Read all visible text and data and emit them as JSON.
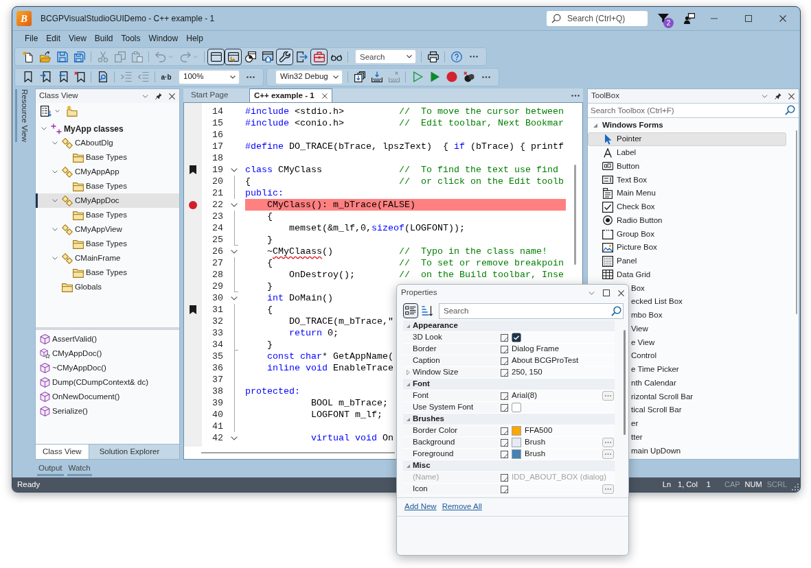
{
  "window": {
    "logo": "B",
    "title": "BCGPVisualStudioGUIDemo - C++ example - 1",
    "search": {
      "placeholder": "Search (Ctrl+Q)"
    },
    "notification_count": "2"
  },
  "menu": [
    "File",
    "Edit",
    "View",
    "Build",
    "Tools",
    "Window",
    "Help"
  ],
  "toolbar_rows": [
    {
      "panels": [
        {
          "items": [
            {
              "kind": "button",
              "pressed": false,
              "disabled": false
            },
            {
              "kind": "button",
              "pressed": false,
              "disabled": false
            },
            {
              "kind": "button",
              "pressed": false,
              "disabled": false
            },
            {
              "kind": "button",
              "pressed": false,
              "disabled": false
            },
            {
              "kind": "separator"
            },
            {
              "kind": "button",
              "pressed": false,
              "disabled": true
            },
            {
              "kind": "button",
              "pressed": false,
              "disabled": true
            },
            {
              "kind": "button",
              "pressed": false,
              "disabled": true
            },
            {
              "kind": "separator"
            },
            {
              "kind": "split-button",
              "pressed": false,
              "disabled": true
            },
            {
              "kind": "split-button",
              "pressed": false,
              "disabled": true
            },
            {
              "kind": "separator"
            },
            {
              "kind": "button",
              "pressed": true,
              "disabled": false
            },
            {
              "kind": "button",
              "pressed": true,
              "disabled": false
            },
            {
              "kind": "button",
              "pressed": false,
              "disabled": false
            },
            {
              "kind": "button",
              "pressed": false,
              "disabled": false
            },
            {
              "kind": "button",
              "pressed": true,
              "disabled": false
            },
            {
              "kind": "button",
              "pressed": false,
              "disabled": false
            },
            {
              "kind": "button",
              "pressed": true,
              "disabled": false
            },
            {
              "kind": "button",
              "pressed": false,
              "disabled": false
            },
            {
              "kind": "separator"
            },
            {
              "kind": "combo",
              "placeholder": "Search"
            },
            {
              "kind": "separator"
            },
            {
              "kind": "button",
              "pressed": false,
              "disabled": false
            },
            {
              "kind": "separator"
            },
            {
              "kind": "button",
              "pressed": false,
              "disabled": false
            },
            {
              "kind": "more"
            }
          ]
        }
      ]
    },
    {
      "panels": [
        {
          "items": [
            {
              "kind": "button",
              "pressed": false,
              "disabled": false
            },
            {
              "kind": "button",
              "pressed": false,
              "disabled": false
            },
            {
              "kind": "button",
              "pressed": false,
              "disabled": false
            },
            {
              "kind": "button",
              "pressed": false,
              "disabled": false
            },
            {
              "kind": "separator"
            },
            {
              "kind": "button",
              "pressed": false,
              "disabled": false
            },
            {
              "kind": "separator"
            },
            {
              "kind": "button",
              "pressed": false,
              "disabled": true
            },
            {
              "kind": "button",
              "pressed": false,
              "disabled": true
            },
            {
              "kind": "separator"
            },
            {
              "kind": "text-button",
              "label": "a·b"
            },
            {
              "kind": "combo",
              "value": "100%"
            },
            {
              "kind": "more"
            }
          ]
        },
        {
          "items": [
            {
              "kind": "combo",
              "value": "Win32 Debug"
            },
            {
              "kind": "separator"
            },
            {
              "kind": "button",
              "pressed": false,
              "disabled": false
            },
            {
              "kind": "button",
              "pressed": false,
              "disabled": false
            },
            {
              "kind": "button",
              "pressed": false,
              "disabled": true
            },
            {
              "kind": "separator"
            },
            {
              "kind": "button",
              "pressed": false,
              "disabled": false
            },
            {
              "kind": "button",
              "pressed": false,
              "disabled": false
            },
            {
              "kind": "button",
              "pressed": false,
              "disabled": false
            },
            {
              "kind": "button",
              "pressed": false,
              "disabled": false
            },
            {
              "kind": "more"
            }
          ]
        }
      ]
    }
  ],
  "side_tabs": [
    "Resource View"
  ],
  "class_view": {
    "title": "Class View",
    "tree": [
      {
        "label": "MyApp classes",
        "kind": "namespace",
        "expanded": true,
        "selected": false,
        "children": [
          {
            "label": "CAboutDlg",
            "kind": "class",
            "expanded": true,
            "selected": false,
            "children": [
              {
                "label": "Base Types",
                "kind": "folder",
                "selected": false
              }
            ]
          },
          {
            "label": "CMyAppApp",
            "kind": "class",
            "expanded": true,
            "selected": false,
            "children": [
              {
                "label": "Base Types",
                "kind": "folder",
                "selected": false
              }
            ]
          },
          {
            "label": "CMyAppDoc",
            "kind": "class",
            "expanded": true,
            "selected": true,
            "children": [
              {
                "label": "Base Types",
                "kind": "folder",
                "selected": false
              }
            ]
          },
          {
            "label": "CMyAppView",
            "kind": "class",
            "expanded": true,
            "selected": false,
            "children": [
              {
                "label": "Base Types",
                "kind": "folder",
                "selected": false
              }
            ]
          },
          {
            "label": "CMainFrame",
            "kind": "class",
            "expanded": true,
            "selected": false,
            "children": [
              {
                "label": "Base Types",
                "kind": "folder",
                "selected": false
              }
            ]
          },
          {
            "label": "Globals",
            "kind": "folder",
            "selected": false
          }
        ]
      }
    ],
    "members": [
      {
        "label": "AssertValid()",
        "kind": "method"
      },
      {
        "label": "CMyAppDoc()",
        "kind": "constructor"
      },
      {
        "label": "~CMyAppDoc()",
        "kind": "method"
      },
      {
        "label": "Dump(CDumpContext& dc)",
        "kind": "method"
      },
      {
        "label": "OnNewDocument()",
        "kind": "method"
      },
      {
        "label": "Serialize()",
        "kind": "method"
      }
    ],
    "tabs": [
      {
        "label": "Class View",
        "selected": true
      },
      {
        "label": "Solution Explorer",
        "selected": false
      }
    ]
  },
  "bottom_tabs": [
    "Output",
    "Watch"
  ],
  "editor": {
    "tabs": [
      {
        "label": "Start Page",
        "selected": false
      },
      {
        "label": "C++ example - 1",
        "selected": true
      }
    ],
    "lines": [
      {
        "number": "14",
        "kind": "plain",
        "bookmark": false,
        "breakpoint": false,
        "tokens": [
          {
            "kind": "keyword",
            "text": "#include"
          },
          {
            "kind": "plain",
            "text": " <stdio.h>          "
          },
          {
            "kind": "comment",
            "text": "//  To move the cursor between"
          }
        ]
      },
      {
        "number": "15",
        "kind": "plain",
        "bookmark": false,
        "breakpoint": false,
        "tokens": [
          {
            "kind": "keyword",
            "text": "#include"
          },
          {
            "kind": "plain",
            "text": " <conio.h>          "
          },
          {
            "kind": "comment",
            "text": "//  Edit toolbar, Next Bookmar"
          }
        ]
      },
      {
        "number": "16",
        "kind": "plain",
        "bookmark": false,
        "breakpoint": false
      },
      {
        "number": "17",
        "kind": "plain",
        "bookmark": false,
        "breakpoint": false,
        "tokens": [
          {
            "kind": "keyword",
            "text": "#define"
          },
          {
            "kind": "plain",
            "text": " DO_TRACE(bTrace, lpszText)  { "
          },
          {
            "kind": "keyword",
            "text": "if"
          },
          {
            "kind": "plain",
            "text": " (bTrace) { printf"
          }
        ]
      },
      {
        "number": "18",
        "kind": "plain",
        "bookmark": false,
        "breakpoint": false
      },
      {
        "number": "19",
        "kind": "start",
        "expanded": true,
        "bookmark": true,
        "breakpoint": false,
        "tokens": [
          {
            "kind": "keyword",
            "text": "class"
          },
          {
            "kind": "plain",
            "text": " CMyClass              "
          },
          {
            "kind": "comment",
            "text": "//  To find the text use find"
          }
        ]
      },
      {
        "number": "20",
        "kind": "body",
        "bookmark": false,
        "breakpoint": false,
        "tokens": [
          {
            "kind": "plain",
            "text": "{                           "
          },
          {
            "kind": "comment",
            "text": "//  or click on the Edit toolb"
          }
        ]
      },
      {
        "number": "21",
        "kind": "body",
        "bookmark": false,
        "breakpoint": false,
        "tokens": [
          {
            "kind": "keyword",
            "text": "public:"
          }
        ]
      },
      {
        "number": "22",
        "kind": "start",
        "expanded": true,
        "bookmark": false,
        "breakpoint": true,
        "tokens": [
          {
            "kind": "plain",
            "text": "    CMyClass(): m_bTrace(FALSE)"
          }
        ]
      },
      {
        "number": "23",
        "kind": "body",
        "bookmark": false,
        "breakpoint": false,
        "tokens": [
          {
            "kind": "plain",
            "text": "    {"
          }
        ]
      },
      {
        "number": "24",
        "kind": "body",
        "bookmark": false,
        "breakpoint": false,
        "tokens": [
          {
            "kind": "plain",
            "text": "        memset(&m_lf,0,"
          },
          {
            "kind": "keyword",
            "text": "sizeof"
          },
          {
            "kind": "plain",
            "text": "(LOGFONT));"
          }
        ]
      },
      {
        "number": "25",
        "kind": "end",
        "bookmark": false,
        "breakpoint": false,
        "tokens": [
          {
            "kind": "plain",
            "text": "    }"
          }
        ]
      },
      {
        "number": "26",
        "kind": "start",
        "expanded": true,
        "bookmark": false,
        "breakpoint": false,
        "tokens": [
          {
            "kind": "plain",
            "text": "    ~"
          },
          {
            "kind": "misspelled",
            "text": "CMyClaass"
          },
          {
            "kind": "plain",
            "text": "()            "
          },
          {
            "kind": "comment",
            "text": "//  Typo in the class name!"
          }
        ]
      },
      {
        "number": "27",
        "kind": "body",
        "bookmark": false,
        "breakpoint": false,
        "tokens": [
          {
            "kind": "plain",
            "text": "    {                       "
          },
          {
            "kind": "comment",
            "text": "//  To set or remove breakpoin"
          }
        ]
      },
      {
        "number": "28",
        "kind": "body",
        "bookmark": false,
        "breakpoint": false,
        "tokens": [
          {
            "kind": "plain",
            "text": "        OnDestroy();        "
          },
          {
            "kind": "comment",
            "text": "//  on the Build toolbar, Inse"
          }
        ]
      },
      {
        "number": "29",
        "kind": "end",
        "bookmark": false,
        "breakpoint": false,
        "tokens": [
          {
            "kind": "plain",
            "text": "    }"
          }
        ]
      },
      {
        "number": "30",
        "kind": "start",
        "expanded": true,
        "bookmark": false,
        "breakpoint": false,
        "tokens": [
          {
            "kind": "keyword",
            "text": "    int"
          },
          {
            "kind": "plain",
            "text": " DoMain()"
          }
        ]
      },
      {
        "number": "31",
        "kind": "body",
        "bookmark": true,
        "breakpoint": false,
        "tokens": [
          {
            "kind": "plain",
            "text": "    {"
          }
        ]
      },
      {
        "number": "32",
        "kind": "body",
        "bookmark": false,
        "breakpoint": false,
        "tokens": [
          {
            "kind": "plain",
            "text": "        DO_TRACE(m_bTrace,\""
          }
        ]
      },
      {
        "number": "33",
        "kind": "body",
        "bookmark": false,
        "breakpoint": false,
        "tokens": [
          {
            "kind": "keyword",
            "text": "        return"
          },
          {
            "kind": "plain",
            "text": " 0;"
          }
        ]
      },
      {
        "number": "34",
        "kind": "end",
        "bookmark": false,
        "breakpoint": false,
        "tokens": [
          {
            "kind": "plain",
            "text": "    }"
          }
        ]
      },
      {
        "number": "35",
        "kind": "body",
        "bookmark": false,
        "breakpoint": false,
        "tokens": [
          {
            "kind": "keyword",
            "text": "    const"
          },
          {
            "kind": "keyword",
            "text": " char"
          },
          {
            "kind": "plain",
            "text": "* GetAppName("
          }
        ]
      },
      {
        "number": "36",
        "kind": "body",
        "bookmark": false,
        "breakpoint": false,
        "tokens": [
          {
            "kind": "keyword",
            "text": "    inline"
          },
          {
            "kind": "keyword",
            "text": " void"
          },
          {
            "kind": "plain",
            "text": " EnableTrace"
          }
        ]
      },
      {
        "number": "37",
        "kind": "body",
        "bookmark": false,
        "breakpoint": false
      },
      {
        "number": "38",
        "kind": "body",
        "bookmark": false,
        "breakpoint": false,
        "tokens": [
          {
            "kind": "keyword",
            "text": "protected:"
          }
        ]
      },
      {
        "number": "39",
        "kind": "body",
        "bookmark": false,
        "breakpoint": false,
        "tokens": [
          {
            "kind": "plain",
            "text": "            BOOL m_bTrace;"
          }
        ]
      },
      {
        "number": "40",
        "kind": "body",
        "bookmark": false,
        "breakpoint": false,
        "tokens": [
          {
            "kind": "plain",
            "text": "            LOGFONT m_lf;"
          }
        ]
      },
      {
        "number": "41",
        "kind": "body",
        "bookmark": false,
        "breakpoint": false
      },
      {
        "number": "42",
        "kind": "start",
        "expanded": true,
        "bookmark": false,
        "breakpoint": false,
        "tokens": [
          {
            "kind": "keyword",
            "text": "            virtual"
          },
          {
            "kind": "keyword",
            "text": " void"
          },
          {
            "kind": "plain",
            "text": " On"
          }
        ]
      }
    ]
  },
  "toolbox": {
    "title": "ToolBox",
    "search": {
      "placeholder": "Search Toolbox (Ctrl+F)"
    },
    "groups": [
      {
        "label": "Windows Forms",
        "expanded": true,
        "items": [
          {
            "label": "Pointer",
            "kind": "pointer",
            "selected": true
          },
          {
            "label": "Label",
            "kind": "label",
            "selected": false
          },
          {
            "label": "Button",
            "kind": "button",
            "selected": false
          },
          {
            "label": "Text Box",
            "kind": "textbox",
            "selected": false
          },
          {
            "label": "Main Menu",
            "kind": "menu",
            "selected": false
          },
          {
            "label": "Check Box",
            "kind": "checkbox",
            "selected": false
          },
          {
            "label": "Radio Button",
            "kind": "radio",
            "selected": false
          },
          {
            "label": "Group Box",
            "kind": "groupbox",
            "selected": false
          },
          {
            "label": "Picture Box",
            "kind": "picturebox",
            "selected": false
          },
          {
            "label": "Panel",
            "kind": "panel",
            "selected": false
          },
          {
            "label": "Data Grid",
            "kind": "datagrid",
            "selected": false
          },
          {
            "label": "Box",
            "kind": "covered",
            "selected": false
          },
          {
            "label": "ecked List Box",
            "kind": "covered",
            "selected": false
          },
          {
            "label": "mbo Box",
            "kind": "covered",
            "selected": false
          },
          {
            "label": "View",
            "kind": "covered",
            "selected": false
          },
          {
            "label": "e View",
            "kind": "covered",
            "selected": false
          },
          {
            "label": "Control",
            "kind": "covered",
            "selected": false
          },
          {
            "label": "e Time Picker",
            "kind": "covered",
            "selected": false
          },
          {
            "label": "nth Calendar",
            "kind": "covered",
            "selected": false
          },
          {
            "label": "rizontal Scroll Bar",
            "kind": "covered",
            "selected": false
          },
          {
            "label": "tical Scroll Bar",
            "kind": "covered",
            "selected": false
          },
          {
            "label": "er",
            "kind": "covered",
            "selected": false
          },
          {
            "label": "tter",
            "kind": "covered",
            "selected": false
          },
          {
            "label": "main UpDown",
            "kind": "covered",
            "selected": false
          }
        ]
      }
    ]
  },
  "status_bar": {
    "text": "Ready",
    "panes": [
      "Ln",
      "1, Col",
      "1"
    ],
    "indicators": [
      {
        "label": "CAP",
        "on": false
      },
      {
        "label": "NUM",
        "on": true
      },
      {
        "label": "SCRL",
        "on": false
      }
    ]
  },
  "properties": {
    "title": "Properties",
    "view_modes": [
      {
        "selected": true
      },
      {
        "selected": false
      }
    ],
    "search": {
      "placeholder": "Search"
    },
    "categories": [
      {
        "label": "Appearance",
        "expanded": true,
        "rows": [
          {
            "name": "3D Look",
            "kind": "checkbox",
            "checked": true,
            "disabled": false,
            "browse": false
          },
          {
            "name": "Border",
            "kind": "text",
            "value": "Dialog Frame",
            "disabled": false,
            "browse": false
          },
          {
            "name": "Caption",
            "kind": "text",
            "value": "About BCGProTest",
            "disabled": false,
            "browse": false
          },
          {
            "name": "Window Size",
            "kind": "text",
            "value": "250, 150",
            "expanded": false,
            "disabled": false,
            "browse": false
          }
        ]
      },
      {
        "label": "Font",
        "expanded": true,
        "rows": [
          {
            "name": "Font",
            "kind": "text",
            "value": "Arial(8)",
            "disabled": false,
            "browse": true
          },
          {
            "name": "Use System Font",
            "kind": "checkbox",
            "checked": false,
            "disabled": false,
            "browse": false
          }
        ]
      },
      {
        "label": "Brushes",
        "expanded": true,
        "rows": [
          {
            "name": "Border Color",
            "kind": "color",
            "color": "#ffa500",
            "value": "FFA500",
            "disabled": false,
            "browse": false
          },
          {
            "name": "Background",
            "kind": "color",
            "color": "#e6ebf3",
            "value": "Brush",
            "disabled": false,
            "browse": true
          },
          {
            "name": "Foreground",
            "kind": "color",
            "color": "#4682b4",
            "value": "Brush",
            "disabled": false,
            "browse": true
          }
        ]
      },
      {
        "label": "Misc",
        "expanded": true,
        "rows": [
          {
            "name": "(Name)",
            "kind": "text",
            "value": "IDD_ABOUT_BOX (dialog)",
            "disabled": true,
            "browse": false
          },
          {
            "name": "Icon",
            "kind": "text",
            "disabled": false,
            "browse": true
          }
        ]
      }
    ],
    "links": [
      "Add New",
      "Remove All"
    ]
  }
}
